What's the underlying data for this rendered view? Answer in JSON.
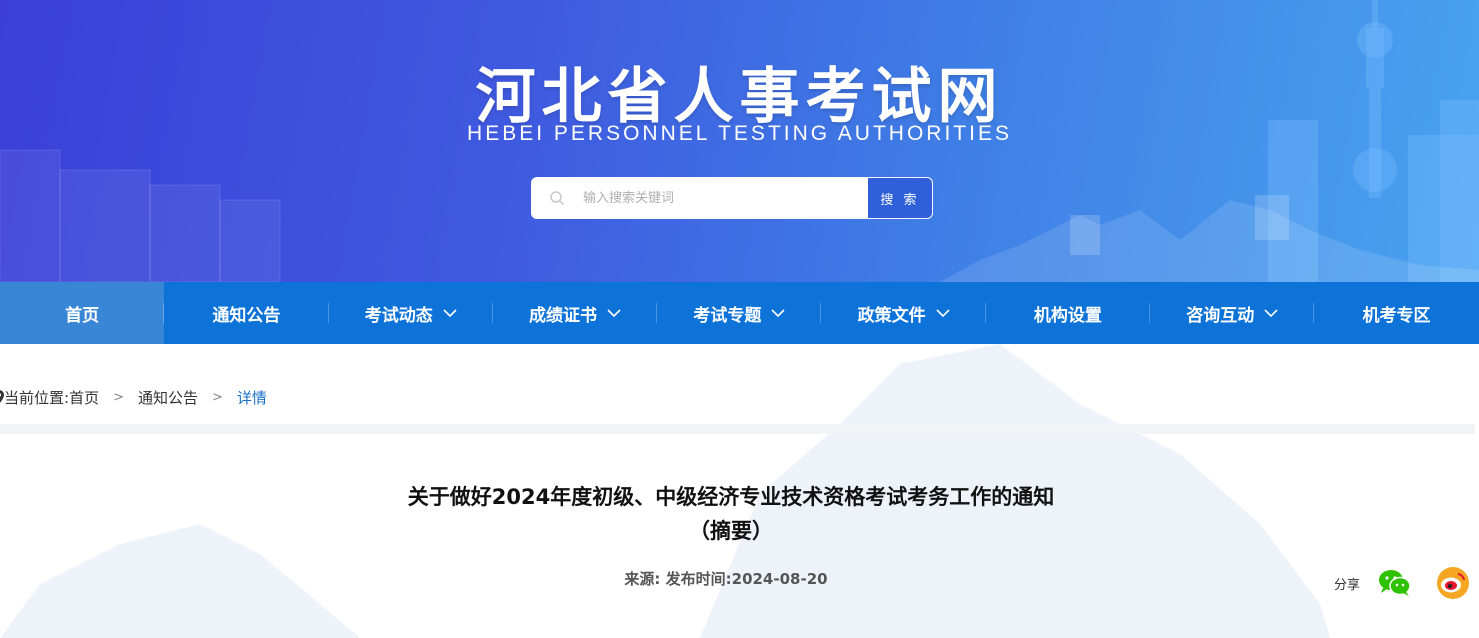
{
  "header": {
    "title": "河北省人事考试网",
    "subtitle": "HEBEI  PERSONNEL  TESTING AUTHORITIES"
  },
  "search": {
    "placeholder": "输入搜索关键词",
    "value": "",
    "button_label": "搜 索"
  },
  "nav": {
    "items": [
      {
        "label": "首页",
        "has_dropdown": false,
        "active": true
      },
      {
        "label": "通知公告",
        "has_dropdown": false,
        "active": false
      },
      {
        "label": "考试动态",
        "has_dropdown": true,
        "active": false
      },
      {
        "label": "成绩证书",
        "has_dropdown": true,
        "active": false
      },
      {
        "label": "考试专题",
        "has_dropdown": true,
        "active": false
      },
      {
        "label": "政策文件",
        "has_dropdown": true,
        "active": false
      },
      {
        "label": "机构设置",
        "has_dropdown": false,
        "active": false
      },
      {
        "label": "咨询互动",
        "has_dropdown": true,
        "active": false
      },
      {
        "label": "机考专区",
        "has_dropdown": false,
        "active": false
      }
    ]
  },
  "breadcrumb": {
    "prefix": "当前位置:",
    "home": "首页",
    "sep1": ">",
    "section": "通知公告",
    "sep2": ">",
    "current": "详情"
  },
  "article": {
    "title_line1": "关于做好2024年度初级、中级经济专业技术资格考试考务工作的通知",
    "title_line2": "（摘要）",
    "meta": "来源:  发布时间:2024-08-20"
  },
  "share": {
    "label": "分享",
    "icons": [
      "wechat-icon",
      "weibo-icon"
    ]
  },
  "colors": {
    "nav_bg": "#0d73d8",
    "nav_active": "#3a86d6",
    "banner_start": "#3b3fd8",
    "banner_end": "#4aa3f0",
    "breadcrumb_current": "#1a6fc9",
    "wechat": "#2dc100",
    "weibo": "#e6162d"
  }
}
